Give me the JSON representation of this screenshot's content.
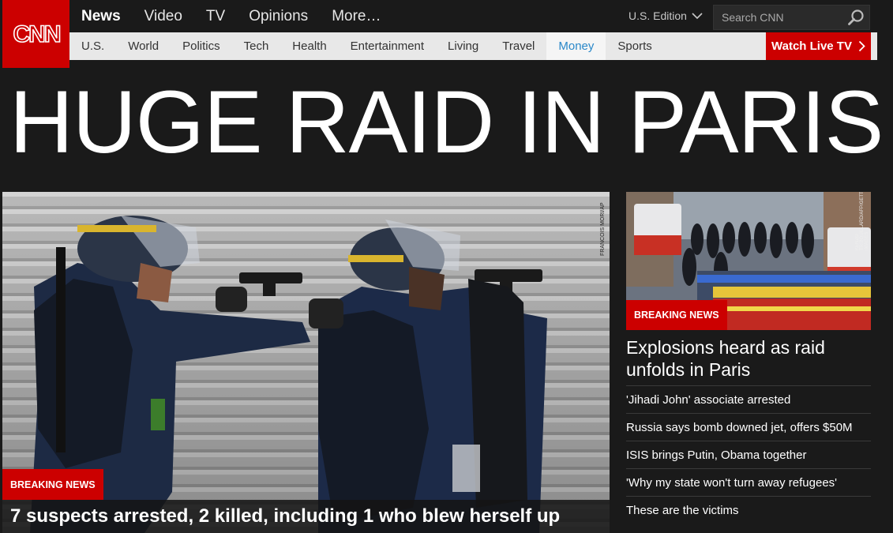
{
  "brand": {
    "logo_text": "CNN",
    "accent": "#cc0000"
  },
  "topnav": {
    "items": [
      {
        "label": "News",
        "active": true
      },
      {
        "label": "Video"
      },
      {
        "label": "TV"
      },
      {
        "label": "Opinions"
      },
      {
        "label": "More…"
      }
    ],
    "edition": "U.S. Edition",
    "search_placeholder": "Search CNN"
  },
  "subnav": {
    "items": [
      "U.S.",
      "World",
      "Politics",
      "Tech",
      "Health",
      "Entertainment",
      "Living",
      "Travel",
      "Money",
      "Sports"
    ],
    "highlighted": "Money",
    "watch_live": "Watch Live TV"
  },
  "headline": "HUGE RAID IN PARIS",
  "hero": {
    "badge": "BREAKING NEWS",
    "caption": "7 suspects arrested, 2 killed, including 1 who blew herself up",
    "photo_credit": "FRANCOIS MORI/AP"
  },
  "side": {
    "badge": "BREAKING NEWS",
    "photo_credit": "KENZO TRIBOUILLARD/AFP/GETTY IMAGES",
    "title": "Explosions heard as raid unfolds in Paris",
    "stories": [
      "'Jihadi John' associate arrested",
      "Russia says bomb downed jet, offers $50M",
      "ISIS brings Putin, Obama together",
      "'Why my state won't turn away refugees'",
      "These are the victims"
    ]
  }
}
